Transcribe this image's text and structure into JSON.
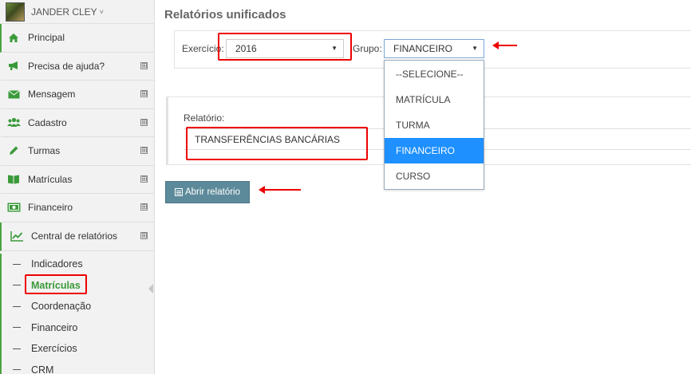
{
  "user": {
    "name": "JANDER CLEY",
    "chevron": "˅"
  },
  "sidebar": {
    "items": [
      {
        "label": "Principal",
        "icon": "home-icon"
      },
      {
        "label": "Precisa de ajuda?",
        "icon": "megaphone-icon"
      },
      {
        "label": "Mensagem",
        "icon": "envelope-icon"
      },
      {
        "label": "Cadastro",
        "icon": "users-icon"
      },
      {
        "label": "Turmas",
        "icon": "pencil-icon"
      },
      {
        "label": "Matrículas",
        "icon": "book-icon"
      },
      {
        "label": "Financeiro",
        "icon": "money-icon"
      },
      {
        "label": "Central de relatórios",
        "icon": "line-chart-icon"
      }
    ],
    "expand_symbol": "⊞",
    "subitems": [
      "Indicadores",
      "Matrículas",
      "Coordenação",
      "Financeiro",
      "Exercícios",
      "CRM"
    ],
    "active_subitem": "Matrículas"
  },
  "page": {
    "title": "Relatórios unificados"
  },
  "filters": {
    "exercicio_label": "Exercício:",
    "exercicio_value": "2016",
    "grupo_label": "Grupo:",
    "grupo_value": "FINANCEIRO",
    "caret": "▼"
  },
  "grupo_options": [
    "--SELECIONE--",
    "MATRÍCULA",
    "TURMA",
    "FINANCEIRO",
    "CURSO"
  ],
  "grupo_selected": "FINANCEIRO",
  "relatorio": {
    "label": "Relatório:",
    "value": "TRANSFERÊNCIAS BANCÁRIAS"
  },
  "actions": {
    "open_label": "Abrir relatório"
  },
  "colors": {
    "accent_green": "#3a9a3a",
    "highlight_red": "#ee0000",
    "button_teal": "#5c8a9a",
    "selected_blue": "#1e90ff"
  }
}
